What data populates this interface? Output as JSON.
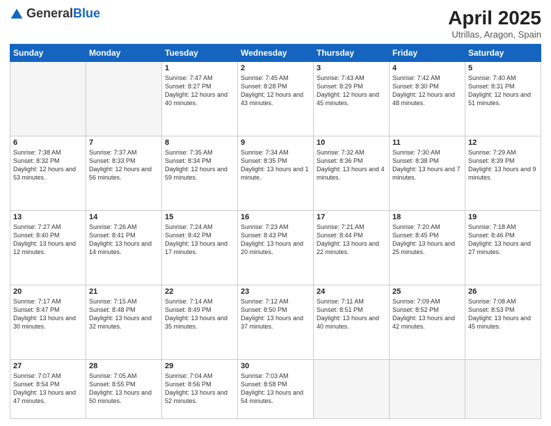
{
  "logo": {
    "general": "General",
    "blue": "Blue"
  },
  "title": "April 2025",
  "subtitle": "Utrillas, Aragon, Spain",
  "days_of_week": [
    "Sunday",
    "Monday",
    "Tuesday",
    "Wednesday",
    "Thursday",
    "Friday",
    "Saturday"
  ],
  "weeks": [
    [
      {
        "num": "",
        "detail": "",
        "empty": true
      },
      {
        "num": "",
        "detail": "",
        "empty": true
      },
      {
        "num": "1",
        "detail": "Sunrise: 7:47 AM\nSunset: 8:27 PM\nDaylight: 12 hours and 40 minutes."
      },
      {
        "num": "2",
        "detail": "Sunrise: 7:45 AM\nSunset: 8:28 PM\nDaylight: 12 hours and 43 minutes."
      },
      {
        "num": "3",
        "detail": "Sunrise: 7:43 AM\nSunset: 8:29 PM\nDaylight: 12 hours and 45 minutes."
      },
      {
        "num": "4",
        "detail": "Sunrise: 7:42 AM\nSunset: 8:30 PM\nDaylight: 12 hours and 48 minutes."
      },
      {
        "num": "5",
        "detail": "Sunrise: 7:40 AM\nSunset: 8:31 PM\nDaylight: 12 hours and 51 minutes."
      }
    ],
    [
      {
        "num": "6",
        "detail": "Sunrise: 7:38 AM\nSunset: 8:32 PM\nDaylight: 12 hours and 53 minutes."
      },
      {
        "num": "7",
        "detail": "Sunrise: 7:37 AM\nSunset: 8:33 PM\nDaylight: 12 hours and 56 minutes."
      },
      {
        "num": "8",
        "detail": "Sunrise: 7:35 AM\nSunset: 8:34 PM\nDaylight: 12 hours and 59 minutes."
      },
      {
        "num": "9",
        "detail": "Sunrise: 7:34 AM\nSunset: 8:35 PM\nDaylight: 13 hours and 1 minute."
      },
      {
        "num": "10",
        "detail": "Sunrise: 7:32 AM\nSunset: 8:36 PM\nDaylight: 13 hours and 4 minutes."
      },
      {
        "num": "11",
        "detail": "Sunrise: 7:30 AM\nSunset: 8:38 PM\nDaylight: 13 hours and 7 minutes."
      },
      {
        "num": "12",
        "detail": "Sunrise: 7:29 AM\nSunset: 8:39 PM\nDaylight: 13 hours and 9 minutes."
      }
    ],
    [
      {
        "num": "13",
        "detail": "Sunrise: 7:27 AM\nSunset: 8:40 PM\nDaylight: 13 hours and 12 minutes."
      },
      {
        "num": "14",
        "detail": "Sunrise: 7:26 AM\nSunset: 8:41 PM\nDaylight: 13 hours and 14 minutes."
      },
      {
        "num": "15",
        "detail": "Sunrise: 7:24 AM\nSunset: 8:42 PM\nDaylight: 13 hours and 17 minutes."
      },
      {
        "num": "16",
        "detail": "Sunrise: 7:23 AM\nSunset: 8:43 PM\nDaylight: 13 hours and 20 minutes."
      },
      {
        "num": "17",
        "detail": "Sunrise: 7:21 AM\nSunset: 8:44 PM\nDaylight: 13 hours and 22 minutes."
      },
      {
        "num": "18",
        "detail": "Sunrise: 7:20 AM\nSunset: 8:45 PM\nDaylight: 13 hours and 25 minutes."
      },
      {
        "num": "19",
        "detail": "Sunrise: 7:18 AM\nSunset: 8:46 PM\nDaylight: 13 hours and 27 minutes."
      }
    ],
    [
      {
        "num": "20",
        "detail": "Sunrise: 7:17 AM\nSunset: 8:47 PM\nDaylight: 13 hours and 30 minutes."
      },
      {
        "num": "21",
        "detail": "Sunrise: 7:15 AM\nSunset: 8:48 PM\nDaylight: 13 hours and 32 minutes."
      },
      {
        "num": "22",
        "detail": "Sunrise: 7:14 AM\nSunset: 8:49 PM\nDaylight: 13 hours and 35 minutes."
      },
      {
        "num": "23",
        "detail": "Sunrise: 7:12 AM\nSunset: 8:50 PM\nDaylight: 13 hours and 37 minutes."
      },
      {
        "num": "24",
        "detail": "Sunrise: 7:11 AM\nSunset: 8:51 PM\nDaylight: 13 hours and 40 minutes."
      },
      {
        "num": "25",
        "detail": "Sunrise: 7:09 AM\nSunset: 8:52 PM\nDaylight: 13 hours and 42 minutes."
      },
      {
        "num": "26",
        "detail": "Sunrise: 7:08 AM\nSunset: 8:53 PM\nDaylight: 13 hours and 45 minutes."
      }
    ],
    [
      {
        "num": "27",
        "detail": "Sunrise: 7:07 AM\nSunset: 8:54 PM\nDaylight: 13 hours and 47 minutes."
      },
      {
        "num": "28",
        "detail": "Sunrise: 7:05 AM\nSunset: 8:55 PM\nDaylight: 13 hours and 50 minutes."
      },
      {
        "num": "29",
        "detail": "Sunrise: 7:04 AM\nSunset: 8:56 PM\nDaylight: 13 hours and 52 minutes."
      },
      {
        "num": "30",
        "detail": "Sunrise: 7:03 AM\nSunset: 8:58 PM\nDaylight: 13 hours and 54 minutes."
      },
      {
        "num": "",
        "detail": "",
        "empty": true
      },
      {
        "num": "",
        "detail": "",
        "empty": true
      },
      {
        "num": "",
        "detail": "",
        "empty": true
      }
    ]
  ]
}
